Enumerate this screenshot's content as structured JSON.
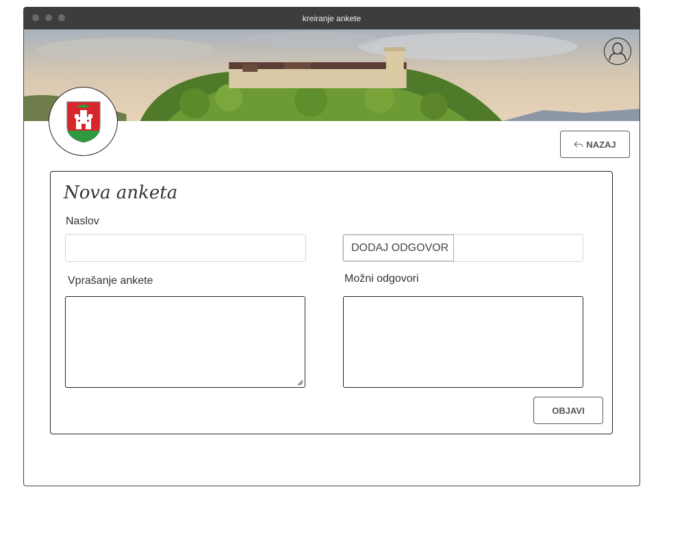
{
  "window": {
    "title": "kreiranje ankete"
  },
  "header": {
    "back_label": "NAZAJ"
  },
  "form": {
    "title": "Nova anketa",
    "naslov_label": "Naslov",
    "naslov_value": "",
    "add_answer_label": "DODAJ ODGOVOR",
    "add_answer_value": "",
    "question_label": "Vprašanje ankete",
    "question_value": "",
    "answers_label": "Možni odgovori",
    "answers_value": "",
    "publish_label": "OBJAVI"
  },
  "icons": {
    "back": "reply-arrow-icon",
    "user": "user-avatar-icon",
    "logo": "castle-coat-of-arms-icon"
  },
  "colors": {
    "titlebar": "#3d3d3d",
    "shield_red": "#d9262b",
    "shield_green": "#2e9a3f",
    "border": "#222222"
  }
}
